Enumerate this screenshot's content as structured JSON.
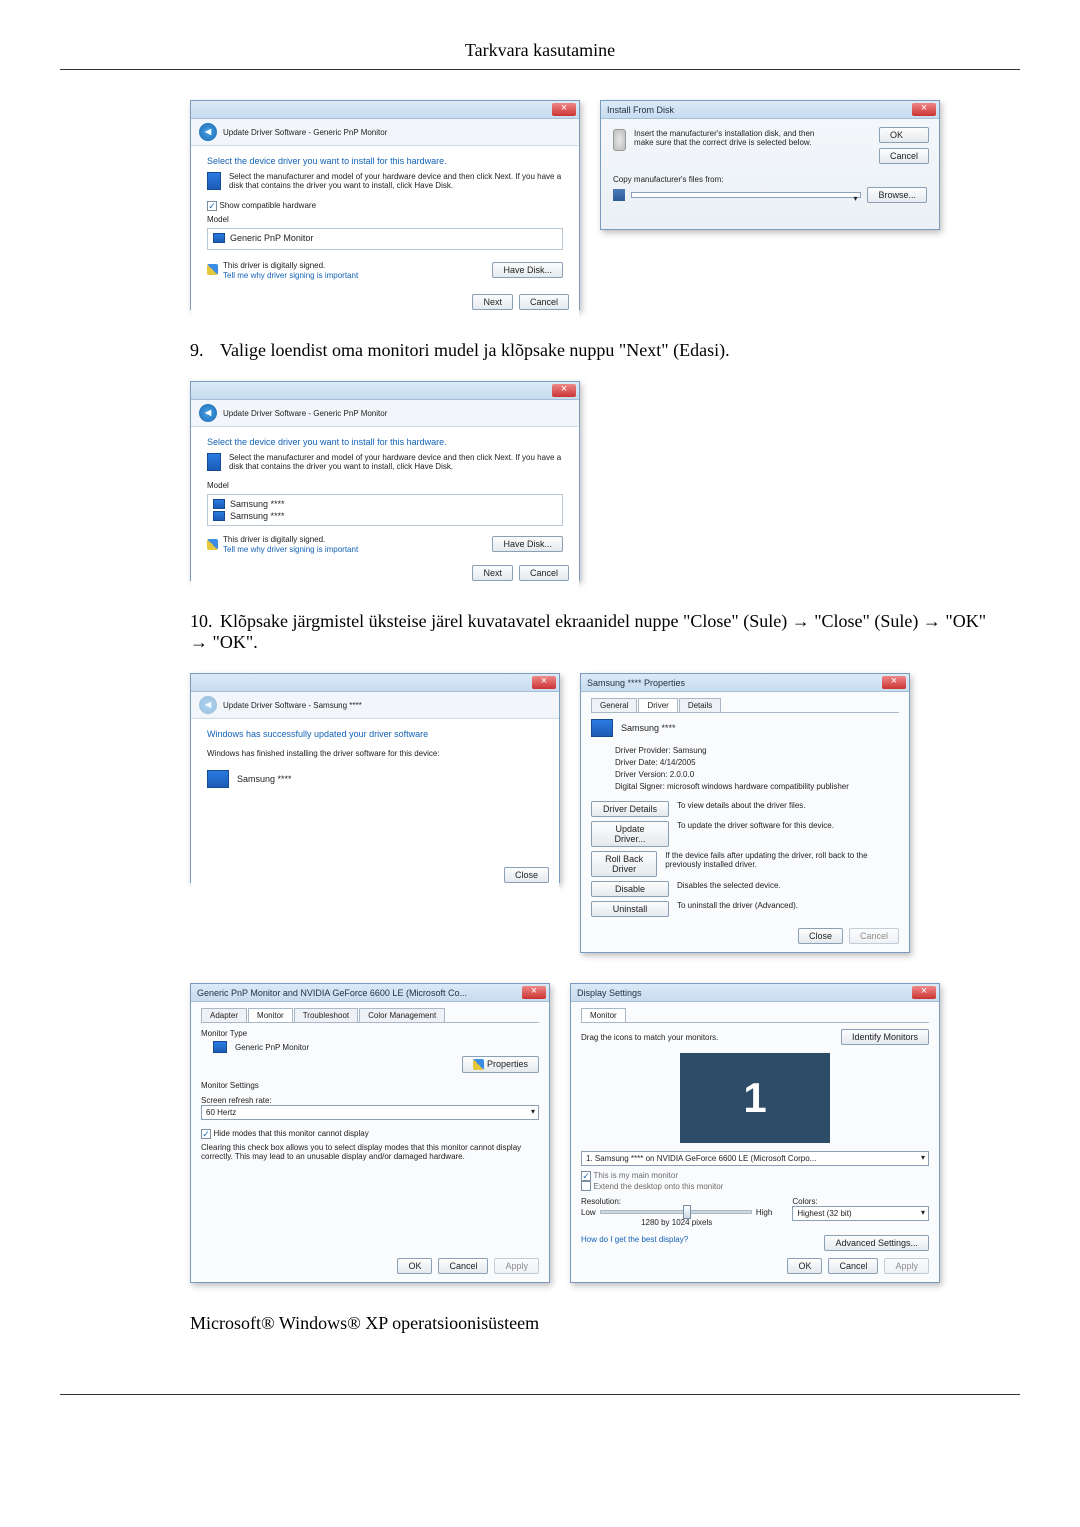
{
  "page_header": "Tarkvara kasutamine",
  "step9": "Valige loendist oma monitori mudel ja klõpsake nuppu \"Next\" (Edasi).",
  "step10": "Klõpsake järgmistel üksteise järel kuvatavatel ekraanidel nuppe \"Close\" (Sule) → \"Close\" (Sule) → \"OK\" → \"OK\".",
  "os_line": "Microsoft® Windows® XP operatsioonisüsteem",
  "driver1": {
    "breadcrumb": "Update Driver Software - Generic PnP Monitor",
    "heading": "Select the device driver you want to install for this hardware.",
    "instruction": "Select the manufacturer and model of your hardware device and then click Next. If you have a disk that contains the driver you want to install, click Have Disk.",
    "show_compatible": "Show compatible hardware",
    "model_label": "Model",
    "model_item": "Generic PnP Monitor",
    "signed": "This driver is digitally signed.",
    "tell_me": "Tell me why driver signing is important",
    "have_disk": "Have Disk...",
    "next": "Next",
    "cancel": "Cancel"
  },
  "install_disk": {
    "title": "Install From Disk",
    "instruction": "Insert the manufacturer's installation disk, and then make sure that the correct drive is selected below.",
    "copy_label": "Copy manufacturer's files from:",
    "ok": "OK",
    "cancel": "Cancel",
    "browse": "Browse..."
  },
  "driver2": {
    "breadcrumb": "Update Driver Software - Generic PnP Monitor",
    "heading": "Select the device driver you want to install for this hardware.",
    "instruction": "Select the manufacturer and model of your hardware device and then click Next. If you have a disk that contains the driver you want to install, click Have Disk.",
    "model_label": "Model",
    "model_item1": "Samsung ****",
    "model_item2": "Samsung ****",
    "signed": "This driver is digitally signed.",
    "tell_me": "Tell me why driver signing is important",
    "have_disk": "Have Disk...",
    "next": "Next",
    "cancel": "Cancel"
  },
  "finish": {
    "breadcrumb": "Update Driver Software - Samsung ****",
    "heading": "Windows has successfully updated your driver software",
    "sub": "Windows has finished installing the driver software for this device:",
    "device": "Samsung ****",
    "close": "Close"
  },
  "props": {
    "title": "Samsung **** Properties",
    "tab_general": "General",
    "tab_driver": "Driver",
    "tab_details": "Details",
    "device": "Samsung ****",
    "provider_label": "Driver Provider:",
    "provider": "Samsung",
    "date_label": "Driver Date:",
    "date": "4/14/2005",
    "version_label": "Driver Version:",
    "version": "2.0.0.0",
    "signer_label": "Digital Signer:",
    "signer": "microsoft windows hardware compatibility publisher",
    "details_btn": "Driver Details",
    "details_desc": "To view details about the driver files.",
    "update_btn": "Update Driver...",
    "update_desc": "To update the driver software for this device.",
    "rollback_btn": "Roll Back Driver",
    "rollback_desc": "If the device fails after updating the driver, roll back to the previously installed driver.",
    "disable_btn": "Disable",
    "disable_desc": "Disables the selected device.",
    "uninstall_btn": "Uninstall",
    "uninstall_desc": "To uninstall the driver (Advanced).",
    "close": "Close",
    "cancel": "Cancel"
  },
  "monitor_tab": {
    "title": "Generic PnP Monitor and NVIDIA GeForce 6600 LE (Microsoft Co...",
    "tab_adapter": "Adapter",
    "tab_monitor": "Monitor",
    "tab_troubleshoot": "Troubleshoot",
    "tab_color": "Color Management",
    "type_label": "Monitor Type",
    "type_value": "Generic PnP Monitor",
    "properties_btn": "Properties",
    "settings_label": "Monitor Settings",
    "refresh_label": "Screen refresh rate:",
    "refresh_value": "60 Hertz",
    "hide_modes": "Hide modes that this monitor cannot display",
    "hide_desc": "Clearing this check box allows you to select display modes that this monitor cannot display correctly. This may lead to an unusable display and/or damaged hardware.",
    "ok": "OK",
    "cancel": "Cancel",
    "apply": "Apply"
  },
  "display": {
    "title": "Display Settings",
    "tab_monitor": "Monitor",
    "drag_text": "Drag the icons to match your monitors.",
    "identify": "Identify Monitors",
    "monitor_num": "1",
    "monitor_select": "1. Samsung **** on NVIDIA GeForce 6600 LE (Microsoft Corpo...",
    "main_monitor": "This is my main monitor",
    "extend": "Extend the desktop onto this monitor",
    "resolution_label": "Resolution:",
    "low": "Low",
    "high": "High",
    "resolution_value": "1280 by 1024 pixels",
    "colors_label": "Colors:",
    "colors_value": "Highest (32 bit)",
    "best_display": "How do I get the best display?",
    "advanced": "Advanced Settings...",
    "ok": "OK",
    "cancel": "Cancel",
    "apply": "Apply"
  }
}
